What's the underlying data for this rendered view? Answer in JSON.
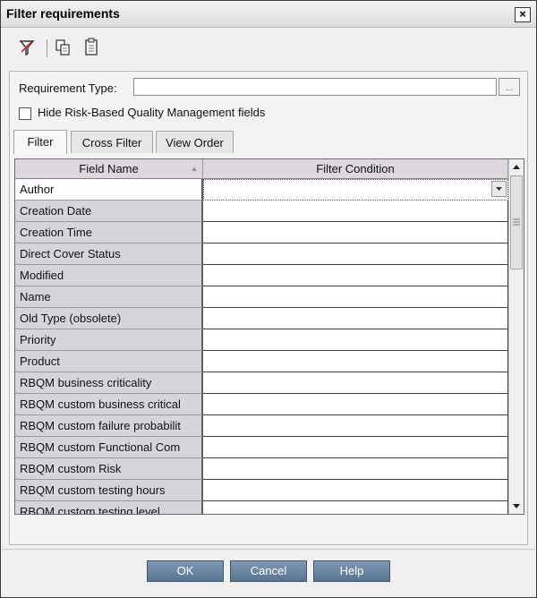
{
  "dialog": {
    "title": "Filter requirements",
    "close_glyph": "×"
  },
  "toolbar": {
    "icons": [
      "filter-clear-icon",
      "copy-icon",
      "paste-icon"
    ]
  },
  "requirement_type": {
    "label": "Requirement Type:",
    "value": "",
    "ellipsis": "..."
  },
  "hide_rbqm": {
    "label": "Hide Risk-Based Quality Management fields",
    "checked": false
  },
  "tabs": [
    {
      "label": "Filter",
      "active": true
    },
    {
      "label": "Cross Filter",
      "active": false
    },
    {
      "label": "View Order",
      "active": false
    }
  ],
  "grid": {
    "columns": [
      "Field Name",
      "Filter Condition"
    ],
    "rows": [
      {
        "field": "Author",
        "condition": ""
      },
      {
        "field": "Creation Date",
        "condition": ""
      },
      {
        "field": "Creation Time",
        "condition": ""
      },
      {
        "field": "Direct Cover Status",
        "condition": ""
      },
      {
        "field": "Modified",
        "condition": ""
      },
      {
        "field": "Name",
        "condition": ""
      },
      {
        "field": "Old Type (obsolete)",
        "condition": ""
      },
      {
        "field": "Priority",
        "condition": ""
      },
      {
        "field": "Product",
        "condition": ""
      },
      {
        "field": "RBQM business criticality",
        "condition": ""
      },
      {
        "field": "RBQM custom business critical",
        "condition": ""
      },
      {
        "field": "RBQM custom failure probabilit",
        "condition": ""
      },
      {
        "field": "RBQM custom Functional Com",
        "condition": ""
      },
      {
        "field": "RBQM custom Risk",
        "condition": ""
      },
      {
        "field": "RBQM custom testing hours",
        "condition": ""
      },
      {
        "field": "RBQM custom testing level",
        "condition": ""
      }
    ]
  },
  "buttons": {
    "ok": "OK",
    "cancel": "Cancel",
    "help": "Help"
  },
  "colors": {
    "button_fill": "#6a86a3",
    "field_cell": "#d8d4dc"
  }
}
